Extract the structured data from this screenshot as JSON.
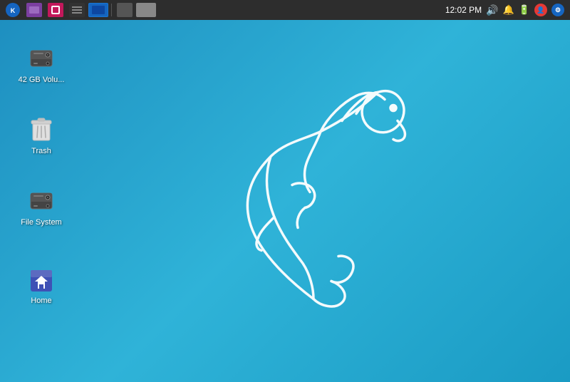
{
  "taskbar": {
    "clock": "12:02 PM",
    "apps": [
      {
        "name": "kali-dragon-app",
        "label": "Kali"
      },
      {
        "name": "app-purple",
        "label": ""
      },
      {
        "name": "app-pink",
        "label": ""
      },
      {
        "name": "app-dark",
        "label": ""
      },
      {
        "name": "app-darkblue",
        "label": ""
      },
      {
        "name": "app-gray1",
        "label": ""
      },
      {
        "name": "app-gray2",
        "label": ""
      }
    ]
  },
  "desktop": {
    "icons": [
      {
        "id": "volume",
        "label": "42 GB Volu...",
        "type": "hdd"
      },
      {
        "id": "trash",
        "label": "Trash",
        "type": "trash"
      },
      {
        "id": "filesystem",
        "label": "File System",
        "type": "hdd"
      },
      {
        "id": "home",
        "label": "Home",
        "type": "home"
      }
    ]
  }
}
